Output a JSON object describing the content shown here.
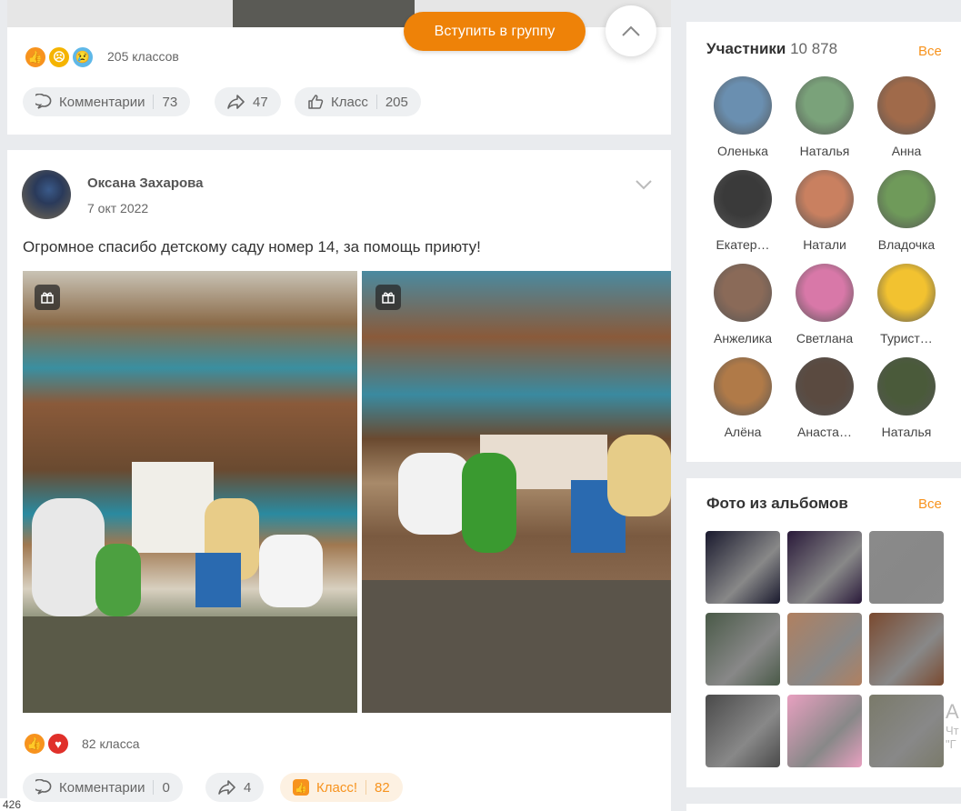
{
  "top_post": {
    "reactions_count": "205 классов",
    "join_button": "Вступить в группу",
    "comments_label": "Комментарии",
    "comments_count": "73",
    "shares_count": "47",
    "class_label": "Класс",
    "class_count": "205"
  },
  "post": {
    "author": "Оксана Захарова",
    "date": "7 окт 2022",
    "text": "Огромное спасибо детскому саду номер 14, за помощь приюту!",
    "reactions_count": "82 класса",
    "comments_label": "Комментарии",
    "comments_count": "0",
    "shares_count": "4",
    "class_label": "Класс!",
    "class_count": "82"
  },
  "members": {
    "title": "Участники",
    "count": "10 878",
    "all_link": "Все",
    "items": [
      {
        "name": "Оленька",
        "color": "#6a8fb0"
      },
      {
        "name": "Наталья",
        "color": "#7aa27a"
      },
      {
        "name": "Анна",
        "color": "#a06a4a"
      },
      {
        "name": "Екатер…",
        "color": "#3a3a3a"
      },
      {
        "name": "Натали",
        "color": "#c98060"
      },
      {
        "name": "Владочка",
        "color": "#6f9a5a"
      },
      {
        "name": "Анжелика",
        "color": "#8a6a58"
      },
      {
        "name": "Светлана",
        "color": "#d878a8"
      },
      {
        "name": "Турист…",
        "color": "#f2c230"
      },
      {
        "name": "Алёна",
        "color": "#b07a48"
      },
      {
        "name": "Анаста…",
        "color": "#5a4a40"
      },
      {
        "name": "Наталья",
        "color": "#4a5a3a"
      }
    ]
  },
  "photos": {
    "title": "Фото из альбомов",
    "all_link": "Все",
    "thumbs": [
      {
        "color": "#1a1a2e"
      },
      {
        "color": "#2a1a3a"
      },
      {
        "color": "#8a8a8a"
      },
      {
        "color": "#4a5a48"
      },
      {
        "color": "#b08060"
      },
      {
        "color": "#7a4a30"
      },
      {
        "color": "#4a4a4a"
      },
      {
        "color": "#e8a0c0"
      },
      {
        "color": "#7a7a6a"
      }
    ]
  },
  "page_number": "426",
  "partial_overlay": {
    "big_letter": "А",
    "line1": "Чт",
    "line2": "\"Г"
  }
}
